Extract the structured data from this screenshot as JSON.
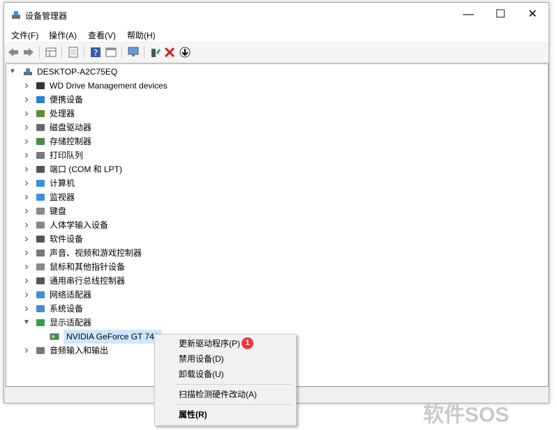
{
  "window": {
    "title": "设备管理器",
    "controls": {
      "minimize": "—",
      "maximize": "☐",
      "close": "✕"
    }
  },
  "menu": [
    "文件(F)",
    "操作(A)",
    "查看(V)",
    "帮助(H)"
  ],
  "toolbar": {
    "icons": [
      "back-arrow-icon",
      "forward-arrow-icon",
      "properties-grid-icon",
      "document-icon",
      "help-icon",
      "view-icon",
      "monitor-icon",
      "add-driver-icon",
      "remove-icon",
      "download-icon"
    ]
  },
  "tree": {
    "root": "DESKTOP-A2C75EQ",
    "items": [
      {
        "label": "WD Drive Management devices",
        "icon": "wd-diamond-icon",
        "expanded": false
      },
      {
        "label": "便携设备",
        "icon": "portable-device-icon",
        "expanded": false
      },
      {
        "label": "处理器",
        "icon": "processor-icon",
        "expanded": false
      },
      {
        "label": "磁盘驱动器",
        "icon": "disk-drive-icon",
        "expanded": false
      },
      {
        "label": "存储控制器",
        "icon": "storage-controller-icon",
        "expanded": false
      },
      {
        "label": "打印队列",
        "icon": "printer-icon",
        "expanded": false
      },
      {
        "label": "端口 (COM 和 LPT)",
        "icon": "port-icon",
        "expanded": false
      },
      {
        "label": "计算机",
        "icon": "computer-icon",
        "expanded": false
      },
      {
        "label": "监视器",
        "icon": "monitor-icon",
        "expanded": false
      },
      {
        "label": "键盘",
        "icon": "keyboard-icon",
        "expanded": false
      },
      {
        "label": "人体学输入设备",
        "icon": "hid-icon",
        "expanded": false
      },
      {
        "label": "软件设备",
        "icon": "software-device-icon",
        "expanded": false
      },
      {
        "label": "声音、视频和游戏控制器",
        "icon": "speaker-icon",
        "expanded": false
      },
      {
        "label": "鼠标和其他指针设备",
        "icon": "mouse-icon",
        "expanded": false
      },
      {
        "label": "通用串行总线控制器",
        "icon": "usb-icon",
        "expanded": false
      },
      {
        "label": "网络适配器",
        "icon": "network-adapter-icon",
        "expanded": false
      },
      {
        "label": "系统设备",
        "icon": "system-device-icon",
        "expanded": false
      },
      {
        "label": "显示适配器",
        "icon": "display-adapter-icon",
        "expanded": true
      },
      {
        "label": "音频输入和输出",
        "icon": "audio-icon",
        "expanded": false
      }
    ],
    "child": "NVIDIA GeForce GT 740"
  },
  "context_menu": {
    "items": [
      "更新驱动程序(P)",
      "禁用设备(D)",
      "卸载设备(U)",
      "扫描检测硬件改动(A)",
      "属性(R)"
    ],
    "badge": "1"
  },
  "watermark": "软件SOS"
}
